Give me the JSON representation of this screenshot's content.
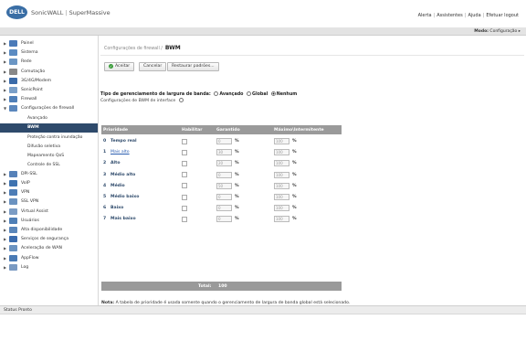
{
  "header": {
    "logo": "DELL",
    "brand": "SonicWALL",
    "product": "SuperMassive",
    "links": [
      "Alerta",
      "Assistentes",
      "Ajuda",
      "Efetuar logout"
    ]
  },
  "modebar": {
    "label": "Modo:",
    "value": "Configuração ▸"
  },
  "sidebar": {
    "items": [
      {
        "label": "Painel",
        "color": "#4a7ab8"
      },
      {
        "label": "Sistema",
        "color": "#5a8bc2"
      },
      {
        "label": "Rede",
        "color": "#6b96c4"
      },
      {
        "label": "Comutação",
        "color": "#888888"
      },
      {
        "label": "3G/4G/Modem",
        "color": "#3a6aa8"
      },
      {
        "label": "SonicPoint",
        "color": "#7a9fc8"
      },
      {
        "label": "Firewall",
        "color": "#4f7fb8"
      },
      {
        "label": "Configurações de firewall",
        "color": "#5b87bd"
      }
    ],
    "subitems": [
      {
        "label": "Avançado",
        "active": false
      },
      {
        "label": "BWM",
        "active": true
      },
      {
        "label": "Proteção contra inundação",
        "active": false
      },
      {
        "label": "Difusão seletiva",
        "active": false
      },
      {
        "label": "Mapeamento QoS",
        "active": false
      },
      {
        "label": "Controle de SSL",
        "active": false
      }
    ],
    "items2": [
      {
        "label": "DPI-SSL",
        "color": "#5681b8"
      },
      {
        "label": "VoIP",
        "color": "#3f73b0"
      },
      {
        "label": "VPN",
        "color": "#4d7db6"
      },
      {
        "label": "SSL VPN",
        "color": "#6a92c0"
      },
      {
        "label": "Virtual Assist",
        "color": "#7b9cc4"
      },
      {
        "label": "Usuários",
        "color": "#4f7fb6"
      },
      {
        "label": "Alta disponibilidade",
        "color": "#5a86ba"
      },
      {
        "label": "Serviços de segurança",
        "color": "#3b6cae"
      },
      {
        "label": "Aceleração de WAN",
        "color": "#6b93c1"
      },
      {
        "label": "AppFlow",
        "color": "#4a7bb5"
      },
      {
        "label": "Log",
        "color": "#7a9ac2"
      }
    ]
  },
  "main": {
    "breadcrumb": "Configurações de firewall /",
    "page_title": "BWM",
    "accept_label": "Aceitar",
    "cancel_label": "Cancelar",
    "restore_label": "Restaurar padrões...",
    "bw_type_label": "Tipo de gerenciamento de largura de banda:",
    "bw_options": [
      {
        "label": "Avançado",
        "selected": false
      },
      {
        "label": "Global",
        "selected": false
      },
      {
        "label": "Nenhum",
        "selected": true
      }
    ],
    "iface_label": "Configurações de BWM de interface"
  },
  "table": {
    "headers": {
      "priority": "Prioridade",
      "enable": "Habilitar",
      "guaranteed": "Garantido",
      "max": "Máximo\\Intermitente"
    },
    "rows": [
      {
        "num": "0",
        "name": "Tempo real",
        "link": false,
        "g": "0",
        "m": "100"
      },
      {
        "num": "1",
        "name": "Mais alto",
        "link": true,
        "g": "30",
        "m": "100"
      },
      {
        "num": "2",
        "name": "Alto",
        "link": false,
        "g": "20",
        "m": "100"
      },
      {
        "num": "3",
        "name": "Médio alto",
        "link": false,
        "g": "0",
        "m": "100"
      },
      {
        "num": "4",
        "name": "Médio",
        "link": false,
        "g": "50",
        "m": "100"
      },
      {
        "num": "5",
        "name": "Médio baixo",
        "link": false,
        "g": "0",
        "m": "100"
      },
      {
        "num": "6",
        "name": "Baixo",
        "link": false,
        "g": "0",
        "m": "100"
      },
      {
        "num": "7",
        "name": "Mais baixo",
        "link": false,
        "g": "0",
        "m": "100"
      }
    ],
    "pct": "%",
    "total_label": "Total:",
    "total_value": "100"
  },
  "note": {
    "label": "Nota:",
    "text": "A tabela de prioridade é usada somente quando o gerenciamento de largura de banda global está selecionado."
  },
  "status": {
    "text": "Status Pronto"
  }
}
